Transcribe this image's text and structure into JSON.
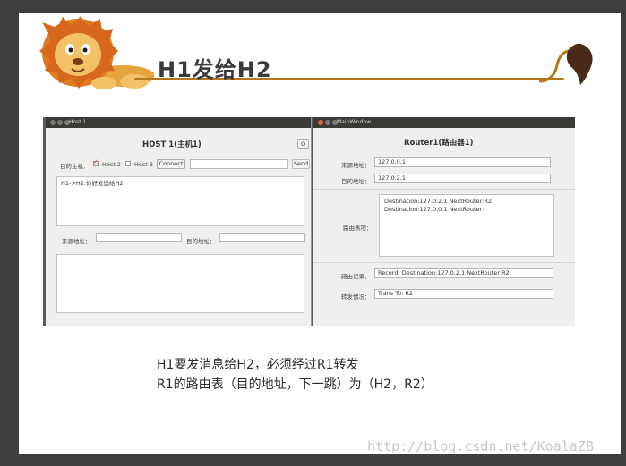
{
  "slide": {
    "title": "H1发给H2",
    "caption_line1": "H1要发消息给H2，必须经过R1转发",
    "caption_line2": "R1的路由表（目的地址，下一跳）为（H2，R2）",
    "watermark": "http://blog.csdn.net/KoalaZB"
  },
  "host1": {
    "window_title": "Host 1",
    "heading": "HOST 1(主机1)",
    "q_button": "Q",
    "target_label": "目的主机：",
    "host2_label": "Host 2",
    "host2_checked": true,
    "host3_label": "Host 3",
    "host3_checked": false,
    "connect_button": "Connect",
    "message_input": "",
    "send_button": "Send",
    "log_text": "H1->H2:你好发送给H2",
    "source_label": "来源地址：",
    "source_value": "",
    "dest_label": "目的地址：",
    "dest_value": "",
    "output_text": ""
  },
  "router": {
    "window_title": "MainWindow",
    "heading": "Router1(路由器1)",
    "source_label": "来源地址：",
    "source_value": "127.0.0.1",
    "dest_label": "目的地址：",
    "dest_value": "127.0.2.1",
    "table_label": "路由表项：",
    "table_rows": [
      "Destination:127.0.2.1  NextRouter:R2",
      "Destination:127.0.0.1  NextRouter:|"
    ],
    "record_label": "路由记录：",
    "record_value": "Record:  Destination:127.0.2.1  NextRouter:R2",
    "forward_label": "转发情况：",
    "forward_value": "Trans To: R2"
  },
  "colors": {
    "accent_line": "#b5761c",
    "frame": "#3e3e3e",
    "titlebar": "#3b3a36"
  }
}
